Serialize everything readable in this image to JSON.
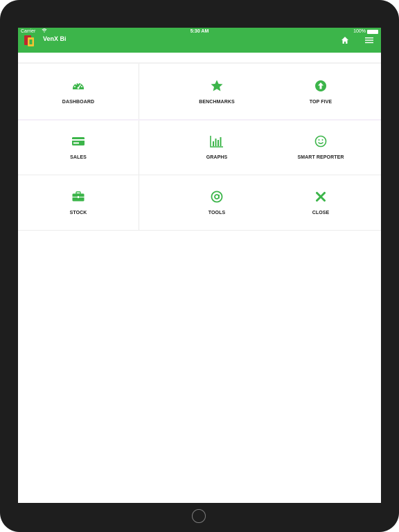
{
  "status_bar": {
    "carrier": "Carrier",
    "time": "5:30 AM",
    "battery": "100%"
  },
  "app": {
    "title": "VenX Bi",
    "brand_color": "#3cb54a"
  },
  "tiles": [
    {
      "label": "DASHBOARD",
      "icon": "speedometer-icon"
    },
    {
      "label": "BENCHMARKS",
      "icon": "star-icon"
    },
    {
      "label": "TOP FIVE",
      "icon": "arrow-up-circle-icon"
    },
    {
      "label": "SALES",
      "icon": "credit-card-icon"
    },
    {
      "label": "GRAPHS",
      "icon": "bar-chart-icon"
    },
    {
      "label": "SMART REPORTER",
      "icon": "smiley-icon"
    },
    {
      "label": "STOCK",
      "icon": "briefcase-icon"
    },
    {
      "label": "TOOLS",
      "icon": "at-sign-icon"
    },
    {
      "label": "CLOSE",
      "icon": "close-icon"
    }
  ]
}
